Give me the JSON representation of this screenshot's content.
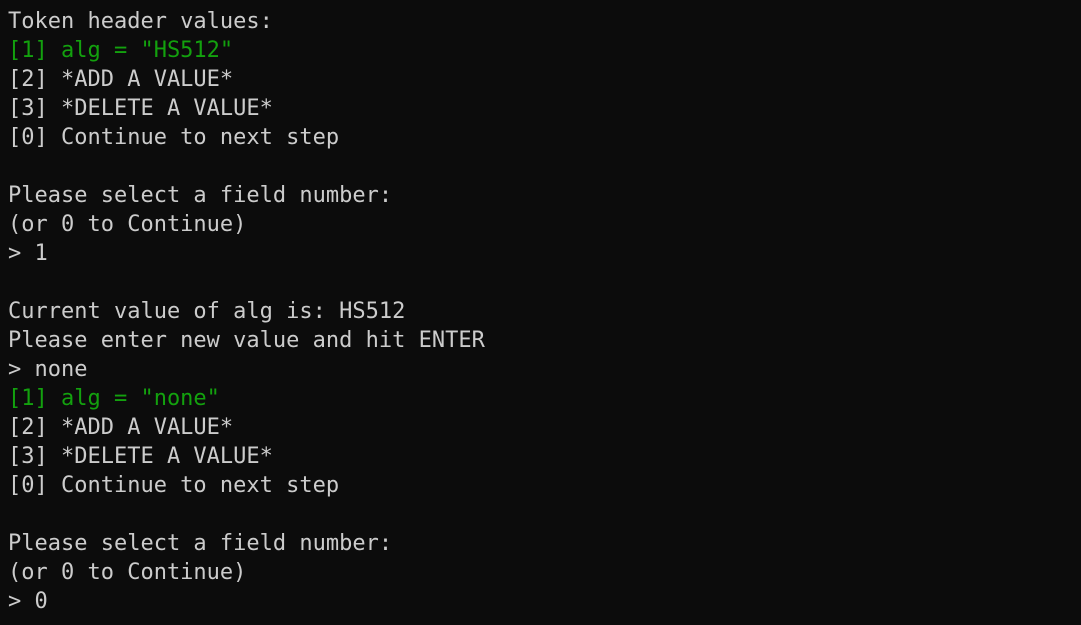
{
  "terminal": {
    "colors": {
      "background": "#0c0c0c",
      "foreground": "#cccccc",
      "highlight": "#13a10e"
    },
    "lines": [
      {
        "text": "Token header values:",
        "color": "default"
      },
      {
        "text": "[1] alg = \"HS512\"",
        "color": "green"
      },
      {
        "text": "[2] *ADD A VALUE*",
        "color": "default"
      },
      {
        "text": "[3] *DELETE A VALUE*",
        "color": "default"
      },
      {
        "text": "[0] Continue to next step",
        "color": "default"
      },
      {
        "text": "",
        "color": "default"
      },
      {
        "text": "Please select a field number:",
        "color": "default"
      },
      {
        "text": "(or 0 to Continue)",
        "color": "default"
      },
      {
        "text": "> 1",
        "color": "default"
      },
      {
        "text": "",
        "color": "default"
      },
      {
        "text": "Current value of alg is: HS512",
        "color": "default"
      },
      {
        "text": "Please enter new value and hit ENTER",
        "color": "default"
      },
      {
        "text": "> none",
        "color": "default"
      },
      {
        "text": "[1] alg = \"none\"",
        "color": "green"
      },
      {
        "text": "[2] *ADD A VALUE*",
        "color": "default"
      },
      {
        "text": "[3] *DELETE A VALUE*",
        "color": "default"
      },
      {
        "text": "[0] Continue to next step",
        "color": "default"
      },
      {
        "text": "",
        "color": "default"
      },
      {
        "text": "Please select a field number:",
        "color": "default"
      },
      {
        "text": "(or 0 to Continue)",
        "color": "default"
      },
      {
        "text": "> 0",
        "color": "default"
      }
    ]
  }
}
